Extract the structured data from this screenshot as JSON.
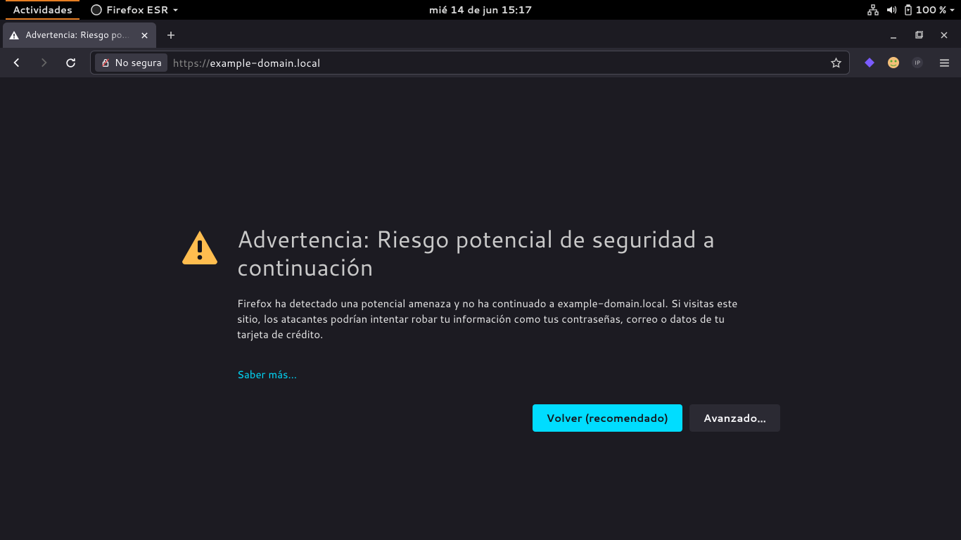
{
  "gnome": {
    "activities": "Actividades",
    "app_name": "Firefox ESR",
    "clock": "mié 14 de jun  15:17",
    "battery": "100 %"
  },
  "firefox": {
    "tab": {
      "title": "Advertencia: Riesgo potencial de seguridad a continuación"
    },
    "identity_label": "No segura",
    "url_scheme": "https://",
    "url_host": "example-domain.local",
    "url_path": ""
  },
  "page": {
    "title": "Advertencia: Riesgo potencial de seguridad a continuación",
    "body": "Firefox ha detectado una potencial amenaza y no ha continuado a example-domain.local. Si visitas este sitio, los atacantes podrían intentar robar tu información como tus contraseñas, correo o datos de tu tarjeta de crédito.",
    "learn_more": "Saber más…",
    "back_button": "Volver (recomendado)",
    "advanced_button": "Avanzado…"
  }
}
